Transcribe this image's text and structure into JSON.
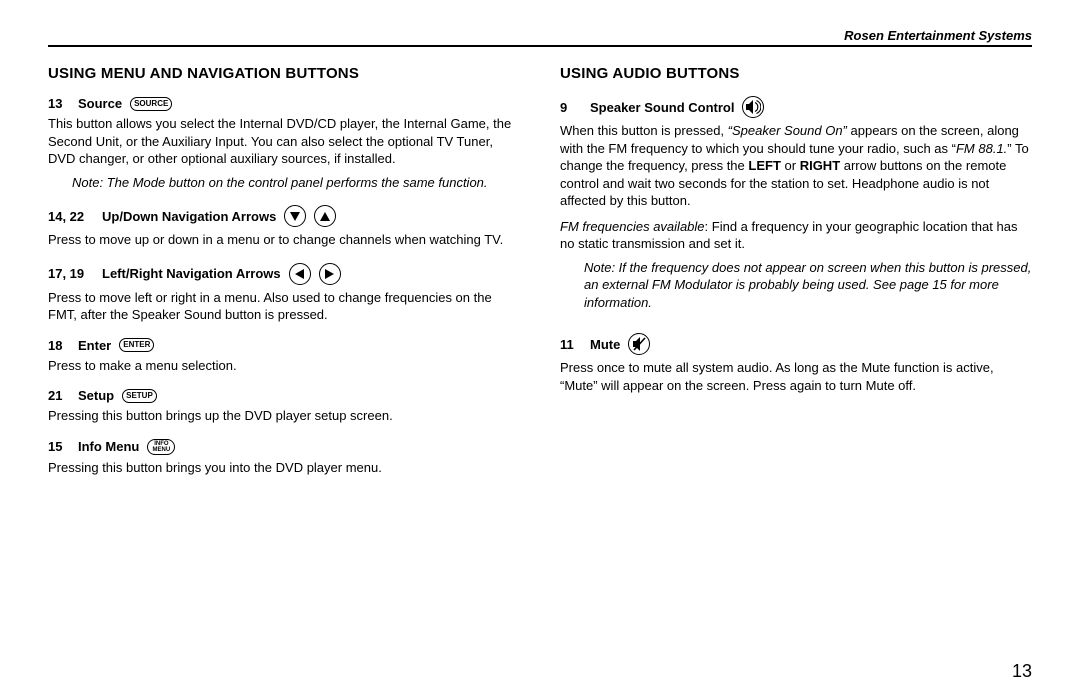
{
  "brand": "Rosen Entertainment Systems",
  "page_number": "13",
  "left": {
    "heading": "USING MENU AND NAVIGATION BUTTONS",
    "items": {
      "source": {
        "num": "13",
        "title": "Source",
        "btn": "SOURCE",
        "body": "This button allows you select the Internal DVD/CD player, the Internal Game, the Second Unit, or the Auxiliary Input. You can also select the optional TV Tuner, DVD changer, or other optional auxiliary sources, if installed.",
        "note": "Note: The Mode button on the control panel performs the same function."
      },
      "updown": {
        "num": "14, 22",
        "title": "Up/Down Navigation Arrows",
        "body": "Press to move up or down in a menu or to change channels when watching TV."
      },
      "leftright": {
        "num": "17, 19",
        "title": "Left/Right Navigation Arrows",
        "body": "Press to move left or right in a menu. Also used to change frequencies on the FMT, after the Speaker Sound button is pressed."
      },
      "enter": {
        "num": "18",
        "title": "Enter",
        "btn": "ENTER",
        "body": "Press to make a menu selection."
      },
      "setup": {
        "num": "21",
        "title": "Setup",
        "btn": "SETUP",
        "body": "Pressing this button brings up the DVD player setup screen."
      },
      "info": {
        "num": "15",
        "title": "Info Menu",
        "btn1": "INFO",
        "btn2": "MENU",
        "body": "Pressing this button brings you into the DVD player menu."
      }
    }
  },
  "right": {
    "heading": "USING AUDIO BUTTONS",
    "items": {
      "speaker": {
        "num": "9",
        "title": "Speaker Sound Control",
        "body_prefix": "When this button is pressed, ",
        "body_quote1": "“Speaker Sound On”",
        "body_mid1": " appears on the screen, along with the FM frequency to which you should tune your radio, such as “",
        "body_em1": "FM 88.1.",
        "body_mid2": "” To change the frequency, press the ",
        "body_bold1": "LEFT",
        "body_mid3": " or ",
        "body_bold2": "RIGHT",
        "body_tail": " arrow buttons on the remote control and wait two seconds for the station to set. Headphone audio is not affected by this button.",
        "note1_em": "FM frequencies available",
        "note1_rest": ": Find a frequency in your geographic location that has no static transmission and set it.",
        "note2": "Note: If the frequency does not appear on screen when this button is pressed, an external FM Modulator is probably being used. See page 15 for more information."
      },
      "mute": {
        "num": "11",
        "title": "Mute",
        "body": "Press once to mute all system audio. As long as the Mute function is active, “Mute” will appear on the screen. Press again to turn Mute off."
      }
    }
  }
}
